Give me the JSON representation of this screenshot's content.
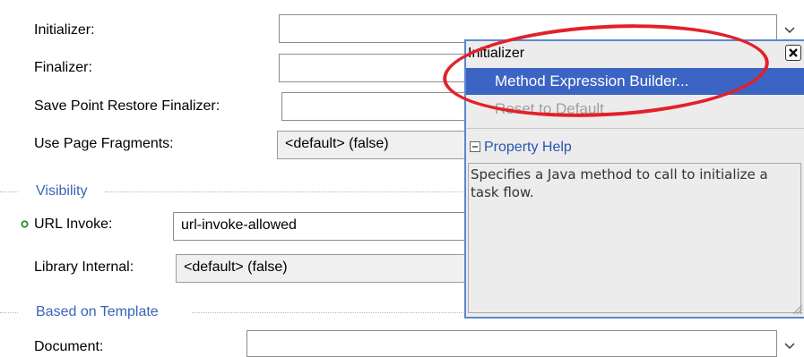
{
  "form": {
    "initializer_label": "Initializer:",
    "finalizer_label": "Finalizer:",
    "save_point_label": "Save Point Restore Finalizer:",
    "use_page_fragments_label": "Use Page Fragments:",
    "use_page_fragments_value": "<default> (false)",
    "visibility_section": "Visibility",
    "url_invoke_label": "URL Invoke:",
    "url_invoke_value": "url-invoke-allowed",
    "library_internal_label": "Library Internal:",
    "library_internal_value": "<default> (false)",
    "based_on_template_section": "Based on Template",
    "document_label": "Document:"
  },
  "popup": {
    "title": "Initializer",
    "close_icon": "close-icon",
    "menu_items": [
      {
        "label": "Method Expression Builder...",
        "state": "highlighted"
      },
      {
        "label": "Reset to Default",
        "state": "disabled"
      }
    ],
    "help_header": "Property Help",
    "help_text": "Specifies a Java method to call to initialize a task flow."
  },
  "colors": {
    "section_text": "#3a63b8",
    "menu_highlight": "#3b64c4",
    "popup_border": "#5a87cf",
    "annotation_ellipse": "#e3202a",
    "modified_indicator": "#2e8b2e"
  }
}
